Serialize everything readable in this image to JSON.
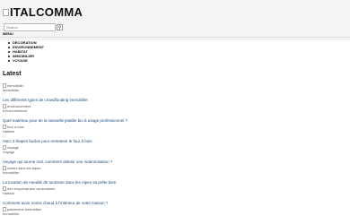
{
  "site": {
    "logo_text": "ITALCOMMA"
  },
  "search": {
    "placeholder": "Search",
    "button_glyph": "⚲"
  },
  "menu": {
    "label": "MENU",
    "items": [
      "DÉCORATION",
      "ENVIRONNEMENT",
      "HABITAT",
      "IMMOBILIER",
      "VOYAGE"
    ]
  },
  "latest": {
    "heading": "Latest",
    "articles": [
      {
        "image_alt": "immobilier",
        "category": "Immobilier",
        "title": "Les différents types de crowdfunding immobilier"
      },
      {
        "image_alt": "environnement",
        "category": "Environnement",
        "title": "Quel matériau pour de la vaisselle jetable bio à usage professionnel ?"
      },
      {
        "image_alt": "four à bois",
        "category": "Habitat",
        "title": "Voici 3 étapes faciles pour entretenir le four à bois"
      },
      {
        "image_alt": "voyage",
        "category": "Voyage",
        "title": "Voyage qui tourne mal, comment obtenir une indemnisation ?"
      },
      {
        "image_alt": "chalet dans les alpes",
        "category": "Immobilier",
        "title": "La location de meublé de tourisme dans les Alpes sa prête bien"
      },
      {
        "image_alt": "des températures caniculaires",
        "category": "Habitat",
        "title": "Comment avoir moins chaud à l'intérieur de votre maison ?"
      },
      {
        "image_alt": "patrimoine immobilier",
        "category": "Immobilier",
        "title": ""
      }
    ]
  }
}
